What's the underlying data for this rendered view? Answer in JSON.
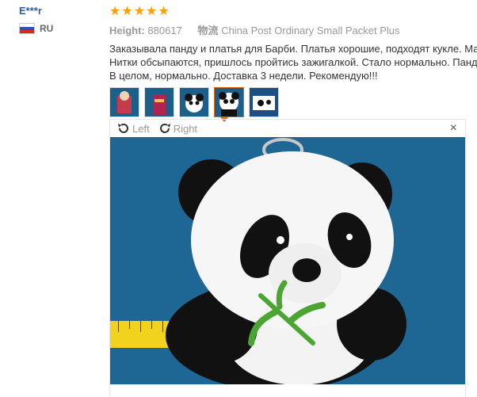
{
  "review": {
    "user": "E***r",
    "country": "RU",
    "rating": 5,
    "height_label": "Height:",
    "height_value": "880617",
    "shipping_label": "物流",
    "shipping_value": "China Post Ordinary Small Packet Plus",
    "text_lines": [
      "Заказывала панду и платья для Барби. Платья хорошие, подходят кукле. Материал",
      "Нитки обсыпаются, пришлось пройтись зажигалкой. Стало нормально. Панда кру",
      "В целом, нормально. Доставка 3 недели. Рекомендую!!!"
    ]
  },
  "viewer": {
    "rotate_left": "Left",
    "rotate_right": "Right",
    "close": "×"
  },
  "colors": {
    "user_link": "#2a5ea6",
    "star": "#ff9d00",
    "active_thumb": "#e66a00",
    "photo_bg": "#1f6a98"
  },
  "icons": [
    "star-icon",
    "flag-icon",
    "rotate-left-icon",
    "rotate-right-icon",
    "close-icon"
  ]
}
